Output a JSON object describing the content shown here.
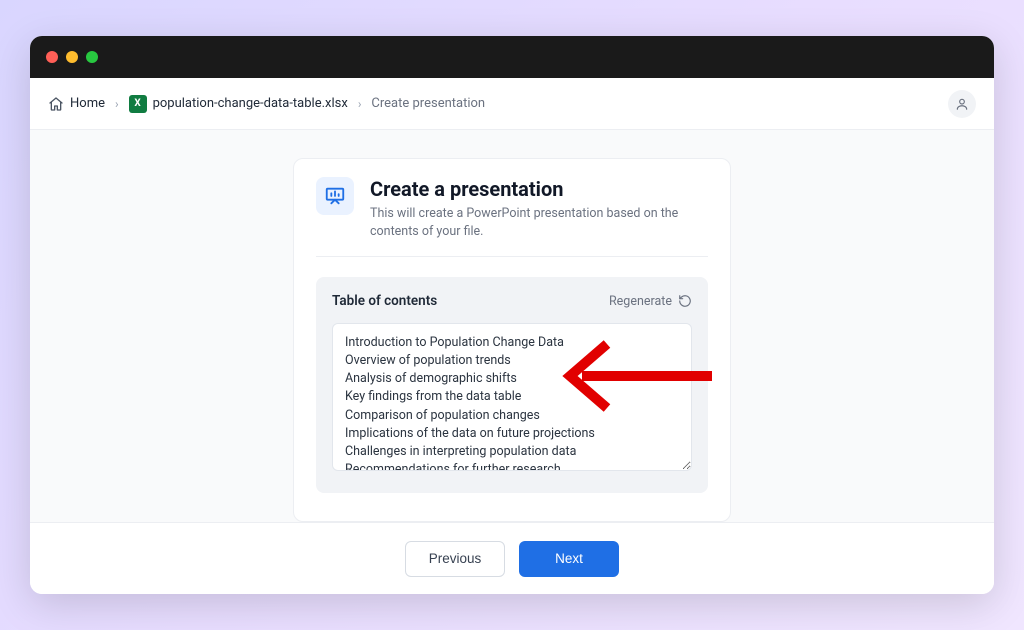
{
  "breadcrumbs": {
    "home_label": "Home",
    "file_label": "population-change-data-table.xlsx",
    "current_label": "Create presentation"
  },
  "card": {
    "title": "Create a presentation",
    "subtitle": "This will create a PowerPoint presentation based on the contents of your file."
  },
  "toc": {
    "heading": "Table of contents",
    "regenerate_label": "Regenerate",
    "items": [
      "Introduction to Population Change Data",
      "Overview of population trends",
      "Analysis of demographic shifts",
      "Key findings from the data table",
      "Comparison of population changes",
      "Implications of the data on future projections",
      "Challenges in interpreting population data",
      "Recommendations for further research"
    ]
  },
  "footer": {
    "previous_label": "Previous",
    "next_label": "Next"
  },
  "colors": {
    "primary": "#1f6fe5",
    "annotation": "#e10000"
  }
}
